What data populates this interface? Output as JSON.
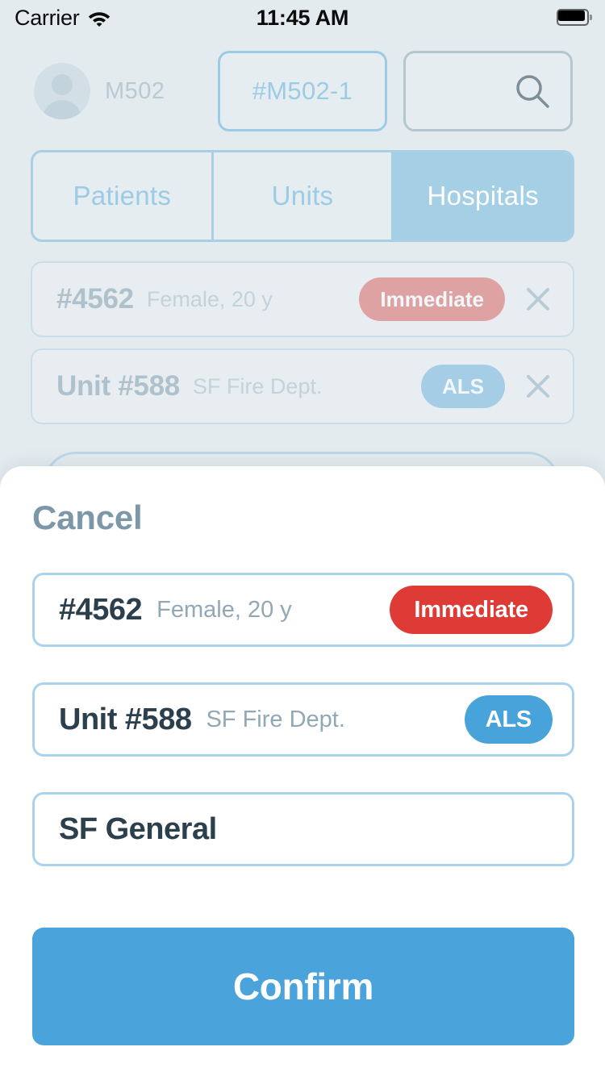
{
  "status_bar": {
    "carrier": "Carrier",
    "wifi_icon": "wifi-icon",
    "time": "11:45 AM",
    "battery_icon": "battery-full-icon"
  },
  "top_bar": {
    "avatar_icon": "person-avatar-icon",
    "unit_label": "M502",
    "incident_pill_label": "#M502-1",
    "search_placeholder": "",
    "search_icon": "search-icon"
  },
  "tabs": {
    "items": [
      {
        "label": "Patients",
        "active": false
      },
      {
        "label": "Units",
        "active": false
      },
      {
        "label": "Hospitals",
        "active": true
      }
    ]
  },
  "background_list": {
    "rows": [
      {
        "id": "#4562",
        "subtitle": "Female, 20 y",
        "badge": "Immediate",
        "badge_color": "#DFA2A2",
        "close_icon": "close-icon"
      },
      {
        "id": "Unit #588",
        "subtitle": "SF Fire Dept.",
        "badge": "ALS",
        "badge_color": "#A5CDE6",
        "close_icon": "close-icon"
      }
    ]
  },
  "sheet": {
    "cancel_label": "Cancel",
    "cards": [
      {
        "title": "#4562",
        "subtitle": "Female, 20 y",
        "badge": "Immediate",
        "badge_color": "#DE3B36"
      },
      {
        "title": "Unit #588",
        "subtitle": "SF Fire Dept.",
        "badge": "ALS",
        "badge_color": "#49A3DB"
      },
      {
        "title": "SF General",
        "subtitle": "",
        "badge": "",
        "badge_color": ""
      }
    ],
    "confirm_label": "Confirm",
    "confirm_color": "#4AA3DB"
  },
  "theme": {
    "background": "#E3EBEF",
    "accent_blue": "#4AA3DB",
    "border_blue": "#A8D3EC",
    "text_dark": "#2B3F4D",
    "text_muted": "#92A8B5",
    "cancel_color": "#7B97A8"
  }
}
